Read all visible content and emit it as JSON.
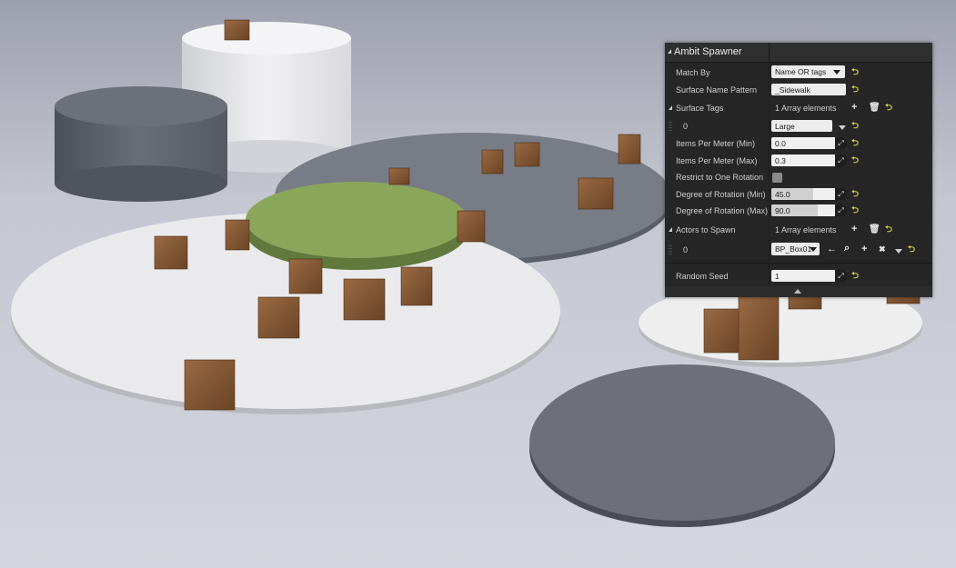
{
  "panel": {
    "title": "Ambit Spawner",
    "match_by": {
      "label": "Match By",
      "value": "Name OR tags"
    },
    "surface_name_pattern": {
      "label": "Surface Name Pattern",
      "value": "_Sidewalk"
    },
    "surface_tags": {
      "label": "Surface Tags",
      "summary": "1 Array elements",
      "item_index": "0",
      "item_value": "Large"
    },
    "items_min": {
      "label": "Items Per Meter (Min)",
      "value": "0.0"
    },
    "items_max": {
      "label": "Items Per Meter (Max)",
      "value": "0.3"
    },
    "restrict": {
      "label": "Restrict to One Rotation",
      "checked": false
    },
    "rot_min": {
      "label": "Degree of Rotation (Min)",
      "value": "45.0",
      "fill_fraction": 0.55
    },
    "rot_max": {
      "label": "Degree of Rotation (Max)",
      "value": "90.0",
      "fill_fraction": 0.62
    },
    "actors": {
      "label": "Actors to Spawn",
      "summary": "1 Array elements",
      "item_index": "0",
      "item_value": "BP_Box01"
    },
    "random_seed": {
      "label": "Random Seed",
      "value": "1"
    }
  },
  "icons": {
    "reset": "⮌",
    "add": "+",
    "delete": "🗑",
    "expand": "⤢",
    "arrow_left": "←",
    "browse": "⌕",
    "clear": "✖"
  },
  "colors": {
    "panel_bg": "#262626",
    "reset_arrow": "#d9d44a",
    "field_bg": "#ececec"
  }
}
